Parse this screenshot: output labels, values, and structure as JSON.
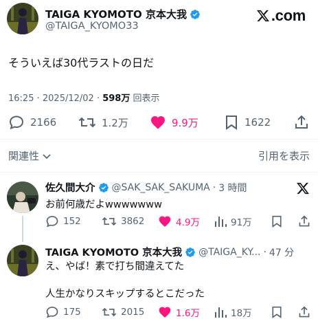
{
  "main_post": {
    "display_name": "TAIGA KYOMOTO 京本大我",
    "handle": "@TAIGA_KYOMO33",
    "text": "そういえば30代ラストの日だ",
    "time": "16:25",
    "date": "2025/12/02",
    "views_count": "598万",
    "views_label": "回表示",
    "replies": "2166",
    "reposts": "1.2万",
    "likes": "9.9万",
    "bookmarks": "1622"
  },
  "brand": {
    "label": ".com",
    "accent": "#1d9bf0",
    "like_color": "#f91880"
  },
  "section": {
    "related_label": "関連性",
    "quotes_label": "引用を表示"
  },
  "reply1": {
    "display_name": "佐久間大介",
    "handle": "@SAK_SAK_SAKUMA",
    "age": "3 時間",
    "text": "お前何歳だよwwwwwww",
    "replies": "152",
    "reposts": "3862",
    "likes": "4.9万",
    "views": "91万"
  },
  "reply2": {
    "display_name": "TAIGA KYOMOTO 京本大我",
    "handle": "@TAIGA_KY...",
    "age": "47 分",
    "text_line1": "え、やば！素で打ち間違えてた",
    "text_line2": "人生かなりスキップするとこだった",
    "replies": "175",
    "reposts": "2015",
    "likes": "1.6万",
    "views": "18万"
  }
}
